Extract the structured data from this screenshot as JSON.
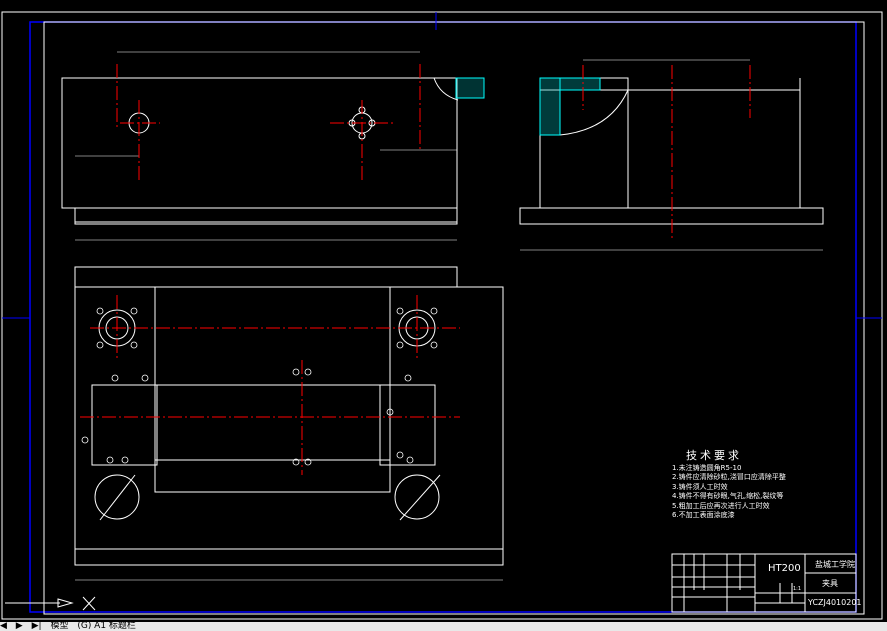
{
  "drawing": {
    "tech_requirements": {
      "title": "技术要求",
      "items": [
        "1.未注铸造圆角R5-10",
        "2.铸件应清除砂粒,浇冒口应清除平整",
        "3.铸件须人工时效",
        "4.铸件不得有砂眼,气孔,缩松,裂纹等",
        "5.粗加工后应再次进行人工时效",
        "6.不加工表面涂底漆"
      ]
    },
    "title_block": {
      "material": "HT200",
      "school": "盐城工学院",
      "part_name": "夹具",
      "drawing_no": "YCZJ4010201",
      "scale": "1:1"
    },
    "colors": {
      "background": "#000000",
      "outline": "#ffffff",
      "centerline": "#ff0000",
      "dimension": "#ffffff",
      "frame": "#0000ff",
      "hatch": "#00ffff",
      "title_text": "#ff00ff"
    }
  },
  "tabs": {
    "nav": [
      "◀",
      "▶",
      "▶|"
    ],
    "items": [
      "模型",
      "(G) A1 标题栏"
    ]
  }
}
